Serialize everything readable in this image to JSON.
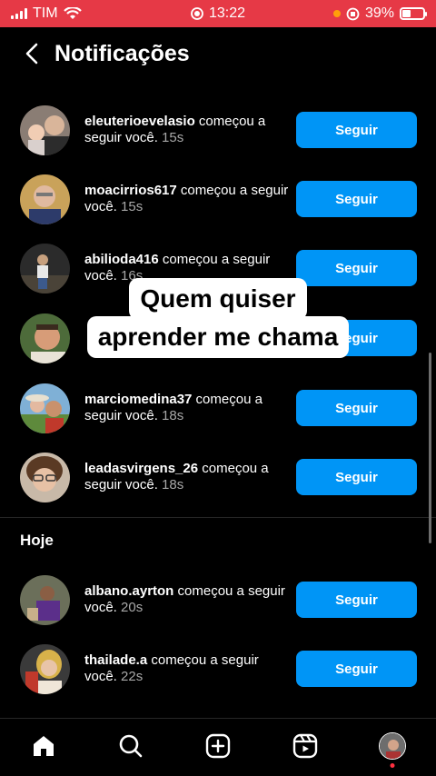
{
  "status_bar": {
    "carrier": "TIM",
    "time": "13:22",
    "battery": "39%",
    "battery_level": 0.39
  },
  "header": {
    "title": "Notificações"
  },
  "section_today": "Hoje",
  "caption": {
    "line1": "Quem quiser",
    "line2": "aprender me chama"
  },
  "follow_label": "Seguir",
  "notifications": [
    {
      "user": "eleuterioevelasio",
      "action": " começou a seguir você. ",
      "time": "15s",
      "avatar_icon": "man-with-child-avatar"
    },
    {
      "user": "moacirrios617",
      "action": " começou a seguir você. ",
      "time": "15s",
      "avatar_icon": "older-man-avatar"
    },
    {
      "user": "abilioda416",
      "action": " começou a seguir você. ",
      "time": "16s",
      "avatar_icon": "man-outdoors-avatar"
    },
    {
      "user": "",
      "action": "",
      "time": "",
      "avatar_icon": "smiling-man-avatar"
    },
    {
      "user": "marciomedina37",
      "action": " começou a seguir você. ",
      "time": "18s",
      "avatar_icon": "couple-avatar"
    },
    {
      "user": "leadasvirgens_26",
      "action": " começou a seguir você. ",
      "time": "18s",
      "avatar_icon": "woman-glasses-avatar"
    },
    {
      "user": "albano.ayrton",
      "action": " começou a seguir você. ",
      "time": "20s",
      "avatar_icon": "man-purple-shirt-avatar"
    },
    {
      "user": "thailade.a",
      "action": " começou a seguir você. ",
      "time": "22s",
      "avatar_icon": "blonde-woman-avatar"
    }
  ],
  "tabs": [
    "home-icon",
    "search-icon",
    "create-icon",
    "reels-icon",
    "profile-avatar"
  ]
}
